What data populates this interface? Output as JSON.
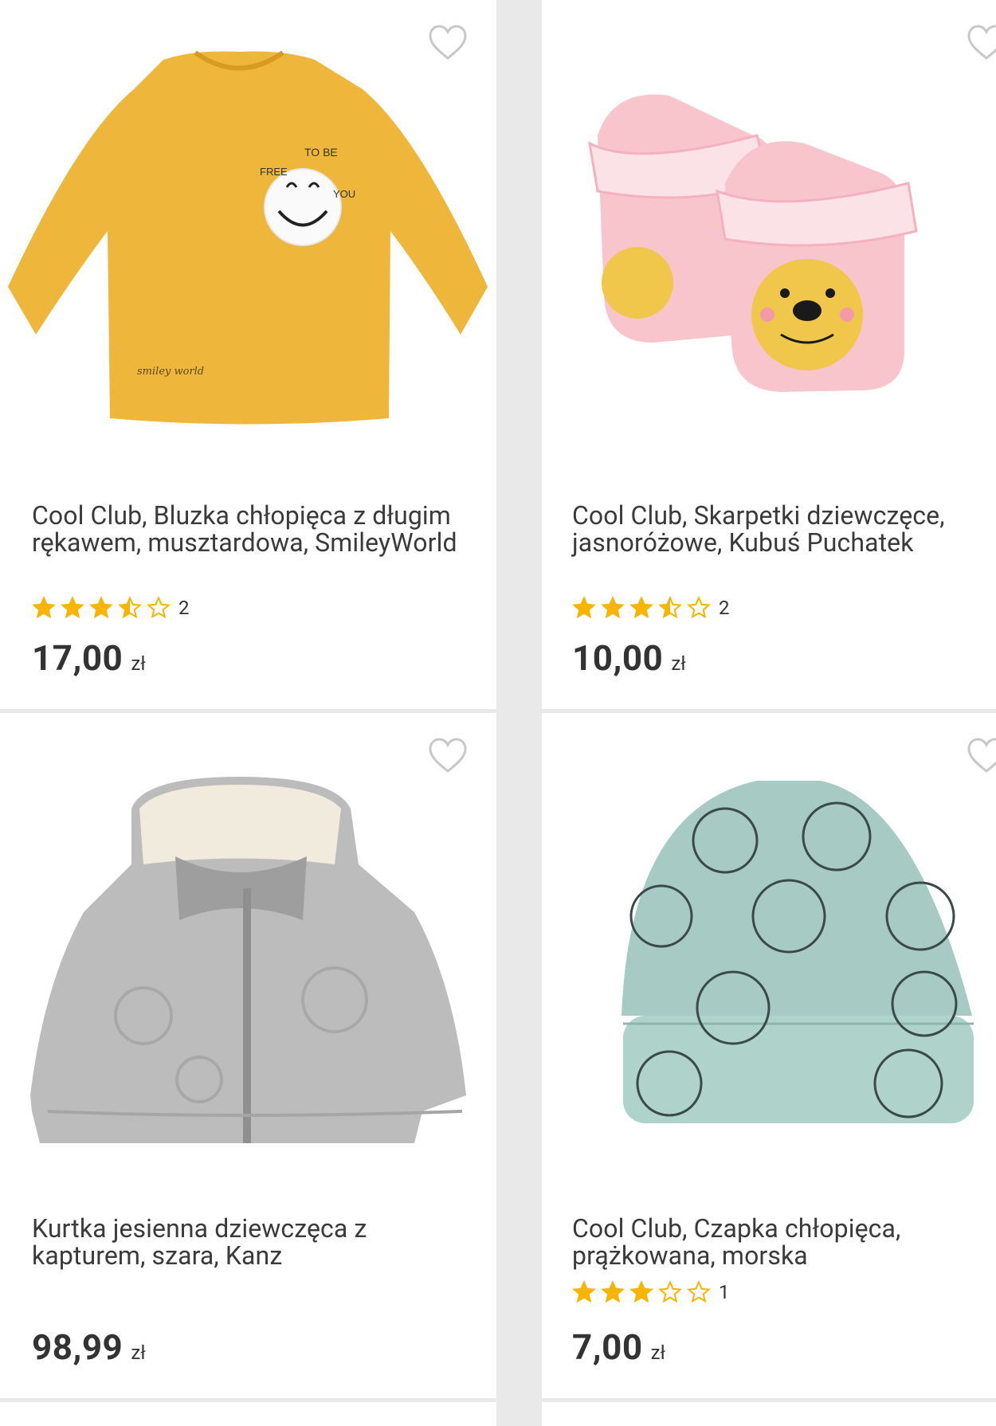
{
  "products": [
    {
      "title": "Cool Club, Bluzka chłopięca z długim rękawem, musztardowa, SmileyWorld",
      "rating": 3.5,
      "review_count": "2",
      "price": "17,00",
      "currency": "zł",
      "image": "mustard-longsleeve-shirt",
      "print_text": {
        "top": "TO BE",
        "left": "FREE",
        "right": "YOU",
        "script": "smiley world"
      }
    },
    {
      "title": "Cool Club, Skarpetki dziewczęce, jasnoróżowe, Kubuś Puchatek",
      "rating": 3.5,
      "review_count": "2",
      "price": "10,00",
      "currency": "zł",
      "image": "pink-baby-socks"
    },
    {
      "title": "Kurtka jesienna dziewczęca z kapturem, szara, Kanz",
      "price": "98,99",
      "currency": "zł",
      "image": "grey-hooded-jacket"
    },
    {
      "title": "Cool Club, Czapka chłopięca, prążkowana, morska",
      "rating": 3,
      "review_count": "1",
      "price": "7,00",
      "currency": "zł",
      "image": "mint-ribbed-hat"
    }
  ],
  "colors": {
    "star": "#f7b500",
    "price": "#333333",
    "heart": "#c8c8c8",
    "background": "#e9e9e9"
  },
  "icons": {
    "favorite": "heart-outline-icon",
    "rating": "star-icon"
  }
}
